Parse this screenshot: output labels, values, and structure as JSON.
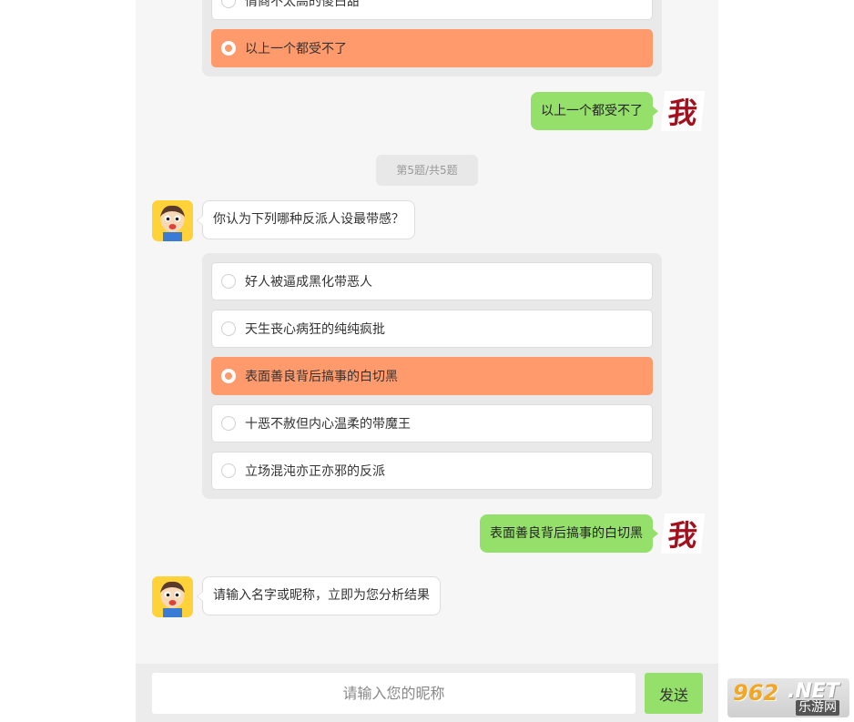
{
  "chat": {
    "prev_options": [
      {
        "label": "情商不太高的傻白甜",
        "selected": false
      },
      {
        "label": "以上一个都受不了",
        "selected": true
      }
    ],
    "reply_1": "以上一个都受不了",
    "me_avatar_text": "我",
    "progress": "第5题/共5题",
    "question": "你认为下列哪种反派人设最带感？",
    "options": [
      {
        "label": "好人被逼成黑化带恶人",
        "selected": false
      },
      {
        "label": "天生丧心病狂的纯纯疯批",
        "selected": false
      },
      {
        "label": "表面善良背后搞事的白切黑",
        "selected": true
      },
      {
        "label": "十恶不赦但内心温柔的带魔王",
        "selected": false
      },
      {
        "label": "立场混沌亦正亦邪的反派",
        "selected": false
      }
    ],
    "reply_2": "表面善良背后搞事的白切黑",
    "prompt": "请输入名字或昵称，立即为您分析结果"
  },
  "input_bar": {
    "placeholder": "请输入您的昵称",
    "send_label": "发送"
  },
  "watermark": {
    "number": "962",
    "net": ".NET",
    "sub": "乐游网"
  },
  "colors": {
    "selected_option": "#ff9a6c",
    "my_bubble": "#95e06a",
    "chat_bg": "#f6f6f6"
  }
}
